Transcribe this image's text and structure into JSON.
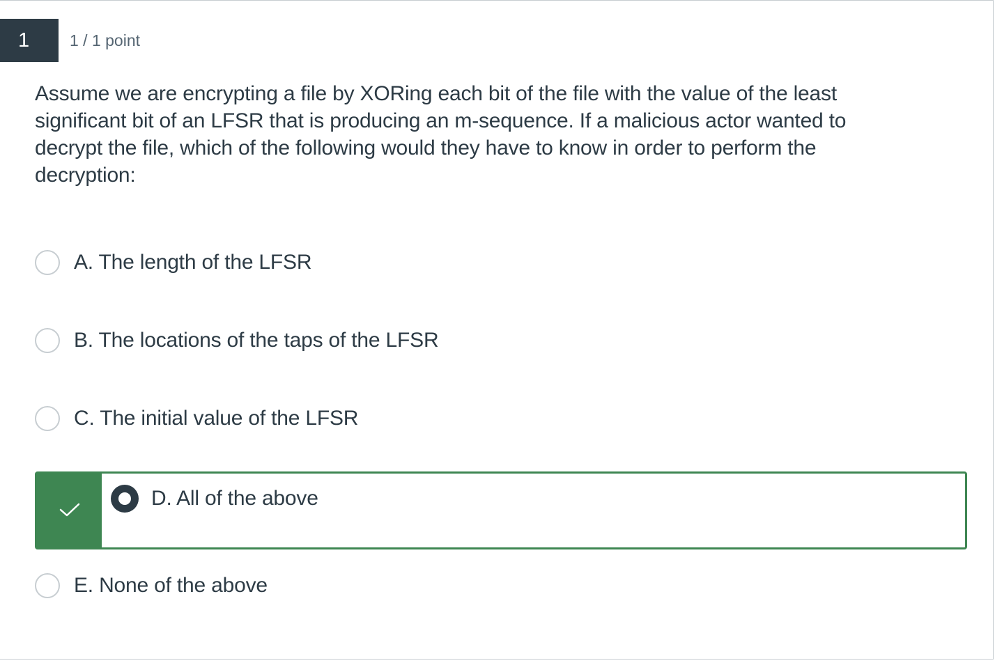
{
  "question": {
    "number": "1",
    "score": "1 / 1 point",
    "text": "Assume we are encrypting a file by XORing each bit of the file with the value of the least significant bit of an LFSR that is producing an m-sequence. If a malicious actor wanted to decrypt the file, which of the following would they have to know in order to perform the decryption:"
  },
  "answers": [
    {
      "label": "A. The length of the LFSR",
      "selected": false
    },
    {
      "label": "B. The locations of the taps of the LFSR",
      "selected": false
    },
    {
      "label": "C. The initial value of the LFSR",
      "selected": false
    },
    {
      "label": "D. All of the above",
      "selected": true,
      "correct": true
    },
    {
      "label": "E. None of the above",
      "selected": false
    }
  ],
  "colors": {
    "question_number_bg": "#2d3b45",
    "correct_green": "#3e8652",
    "text": "#2d3b45",
    "radio_border": "#c7cdd1"
  },
  "icons": {
    "correct_marker": "check-icon"
  }
}
